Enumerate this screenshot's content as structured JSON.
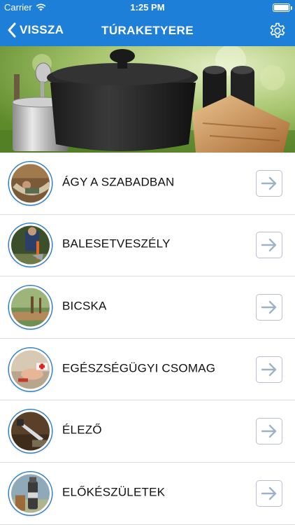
{
  "status_bar": {
    "carrier": "Carrier",
    "time": "1:25 PM"
  },
  "nav": {
    "back_label": "VISSZA",
    "title": "TÚRAKETYERE"
  },
  "items": [
    {
      "label": "ÁGY A SZABADBAN",
      "thumb_icon": "hammock-photo"
    },
    {
      "label": "BALESETVESZÉLY",
      "thumb_icon": "axe-photo"
    },
    {
      "label": "BICSKA",
      "thumb_icon": "knife-log-photo"
    },
    {
      "label": "EGÉSZSÉGÜGYI CSOMAG",
      "thumb_icon": "first-aid-photo"
    },
    {
      "label": "ÉLEZŐ",
      "thumb_icon": "sharpener-photo"
    },
    {
      "label": "ELŐKÉSZÜLETEK",
      "thumb_icon": "gear-bottle-photo"
    }
  ],
  "colors": {
    "bar": "#1e7fd8",
    "accent_ring": "#2f7fc9",
    "arrow": "#9fb3c8"
  }
}
